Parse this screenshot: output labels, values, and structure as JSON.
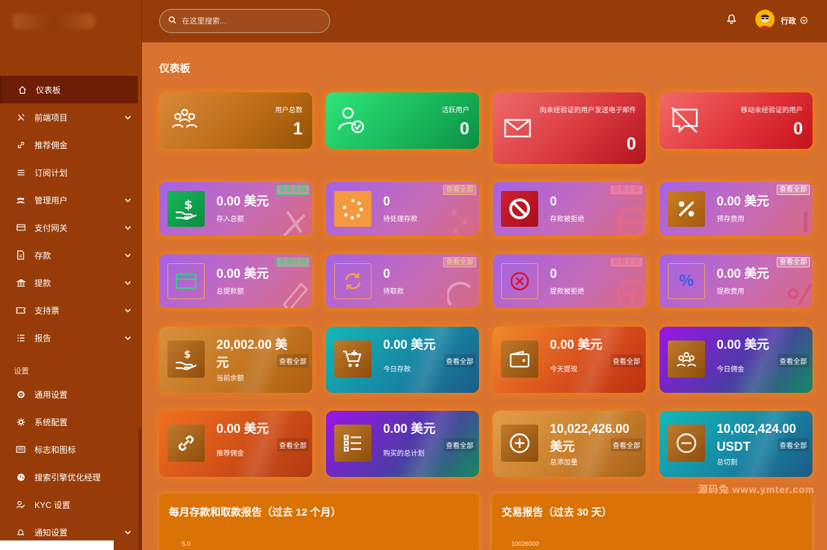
{
  "topbar": {
    "search_placeholder": "在这里搜索...",
    "user_name": "行政"
  },
  "sidebar": {
    "items": [
      {
        "label": "仪表板",
        "active": true,
        "icon": "home-icon"
      },
      {
        "label": "前端项目",
        "icon": "tools-icon",
        "expandable": true
      },
      {
        "label": "推荐佣金",
        "icon": "link-icon"
      },
      {
        "label": "订阅计划",
        "icon": "list-icon"
      },
      {
        "label": "管理用户",
        "icon": "users-icon",
        "expandable": true
      },
      {
        "label": "支付网关",
        "icon": "card-icon",
        "expandable": true
      },
      {
        "label": "存款",
        "icon": "file-icon",
        "expandable": true
      },
      {
        "label": "提款",
        "icon": "bank-icon",
        "expandable": true
      },
      {
        "label": "支持票",
        "icon": "ticket-icon",
        "expandable": true
      },
      {
        "label": "报告",
        "icon": "report-icon",
        "expandable": true
      }
    ],
    "section_label": "设置",
    "settings_items": [
      {
        "label": "通用设置",
        "icon": "cog-icon"
      },
      {
        "label": "系统配置",
        "icon": "gear-icon"
      },
      {
        "label": "标志和图标",
        "icon": "image-icon"
      },
      {
        "label": "搜索引擎优化经理",
        "icon": "globe-icon"
      },
      {
        "label": "KYC 设置",
        "icon": "user-check-icon"
      },
      {
        "label": "通知设置",
        "icon": "bell-icon",
        "expandable": true
      }
    ]
  },
  "page_title": "仪表板",
  "stats": [
    {
      "label": "用户总数",
      "value": "1"
    },
    {
      "label": "活跃用户",
      "value": "0"
    },
    {
      "label": "向未经验证的用户发送电子邮件",
      "value": "0"
    },
    {
      "label": "移动未经验证的用户",
      "value": "0"
    }
  ],
  "view_all": "查看全部",
  "deposit_cards": [
    {
      "value": "0.00 美元",
      "label": "存入总额"
    },
    {
      "value": "0",
      "label": "待处理存款"
    },
    {
      "value": "0",
      "label": "存款被拒绝"
    },
    {
      "value": "0.00 美元",
      "label": "预存费用"
    }
  ],
  "withdraw_cards": [
    {
      "value": "0.00 美元",
      "label": "总提款额"
    },
    {
      "value": "0",
      "label": "待取款"
    },
    {
      "value": "0",
      "label": "提款被拒绝"
    },
    {
      "value": "0.00 美元",
      "label": "提款费用"
    }
  ],
  "balance_cards": [
    {
      "value": "20,002.00 美元",
      "label": "当前余额"
    },
    {
      "value": "0.00 美元",
      "label": "今日存款"
    },
    {
      "value": "0.00 美元",
      "label": "今天提现"
    },
    {
      "value": "0.00 美元",
      "label": "今日佣金"
    }
  ],
  "total_cards": [
    {
      "value": "0.00 美元",
      "label": "推荐佣金"
    },
    {
      "value": "0.00 美元",
      "label": "购买的总计划"
    },
    {
      "value": "10,022,426.00 美元",
      "label": "总添加量"
    },
    {
      "value": "10,002,424.00 USDT",
      "label": "总切割"
    }
  ],
  "charts": [
    {
      "title": "每月存款和取款报告（过去 12 个月）",
      "axis_top": "5.0"
    },
    {
      "title": "交易报告（过去 30 天）",
      "axis_top": "10026000"
    }
  ],
  "watermark": "源码兔 www.ymter.com",
  "colors": {
    "sidebar": "#973c08",
    "main_bg": "#d9732f",
    "active": "#6e1e04"
  }
}
